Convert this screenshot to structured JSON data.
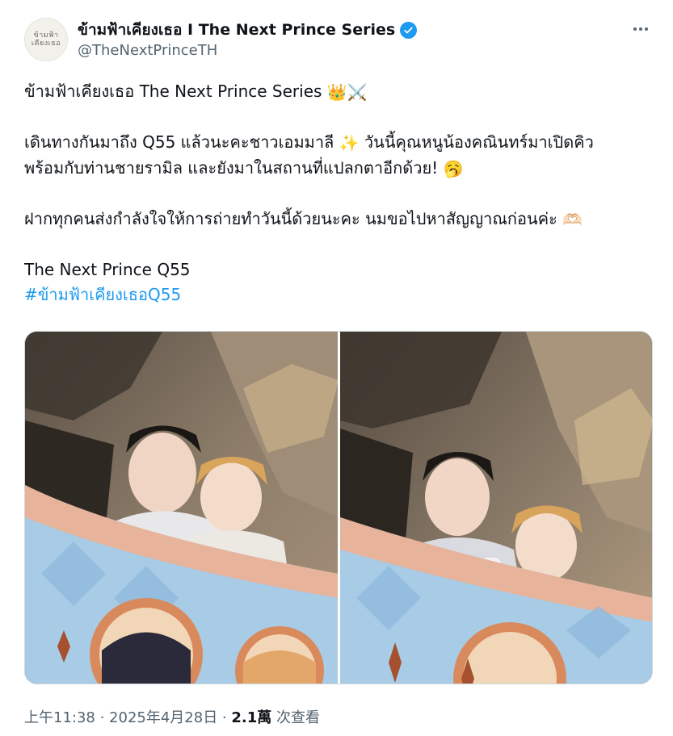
{
  "author": {
    "display_name": "ข้ามฟ้าเคียงเธอ I The Next Prince Series",
    "handle": "@TheNextPrinceTH",
    "avatar_logo_line1": "ข้ามฟ้า",
    "avatar_logo_line2": "เคียงเธอ"
  },
  "tweet": {
    "line1": "ข้ามฟ้าเคียงเธอ The Next Prince Series ",
    "line1_emojis": "👑⚔️",
    "line2": "เดินทางกันมาถึง Q55 แล้วนะคะชาวเอมมาลี ",
    "line2_emoji": "✨",
    "line2_cont": " วันนี้คุณหนูน้องคณินทร์มาเปิดคิว",
    "line3": "พร้อมกับท่านชายรามิล และยังมาในสถานที่แปลกตาอีกด้วย! ",
    "line3_emoji": "🥱",
    "line4": "ฝากทุกคนส่งกำลังใจให้การถ่ายทำวันนี้ด้วยนะคะ นมขอไปหาสัญญาณก่อนค่ะ ",
    "line4_emoji": "🫶🏻",
    "line5": "The Next Prince Q55",
    "hashtag": "#ข้ามฟ้าเคียงเธอQ55"
  },
  "footer": {
    "time": "上午11:38 · 2025年4月28日 · ",
    "views_count": "2.1萬",
    "views_label": " 次查看"
  },
  "colors": {
    "link": "#1d9bf0",
    "secondary_text": "#536471",
    "verified": "#1d9bf0"
  }
}
